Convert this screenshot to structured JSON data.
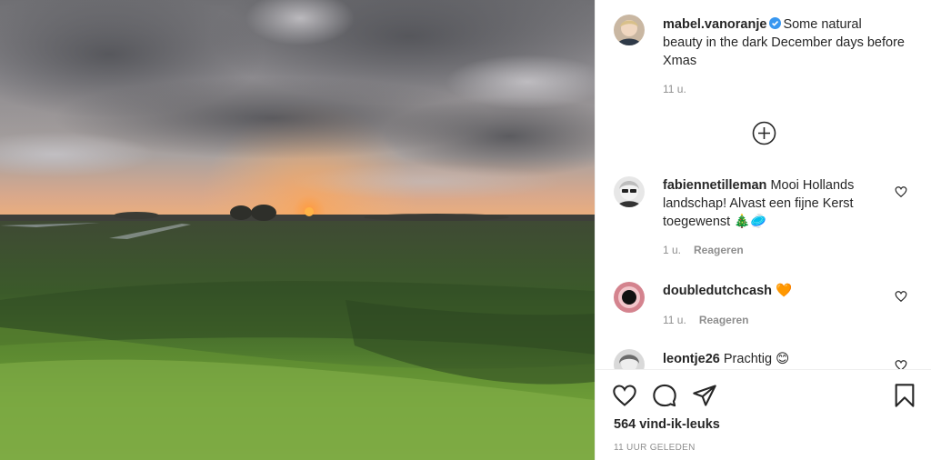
{
  "post": {
    "username": "mabel.vanoranje",
    "caption": "Some natural beauty in the dark December days before Xmas",
    "age": "11 u.",
    "verified_icon": "verified-badge-icon",
    "add_comment_icon": "add-circle-icon"
  },
  "comments": [
    {
      "username": "fabiennetilleman",
      "text": "Mooi Hollands landschap! Alvast een fijne Kerst toegewenst",
      "emoji": "🎄🥏",
      "age": "1 u.",
      "reply_label": "Reageren"
    },
    {
      "username": "doubledutchcash",
      "text": "",
      "emoji": "🧡",
      "age": "11 u.",
      "reply_label": "Reageren"
    },
    {
      "username": "leontje26",
      "text": "Prachtig",
      "emoji": "😊",
      "age": "",
      "reply_label": ""
    }
  ],
  "footer": {
    "likes": "564 vind-ik-leuks",
    "timestamp": "11 UUR GELEDEN"
  },
  "colors": {
    "text": "#262626",
    "muted": "#8e8e8e",
    "verified": "#3897f0",
    "border": "#efefef"
  }
}
